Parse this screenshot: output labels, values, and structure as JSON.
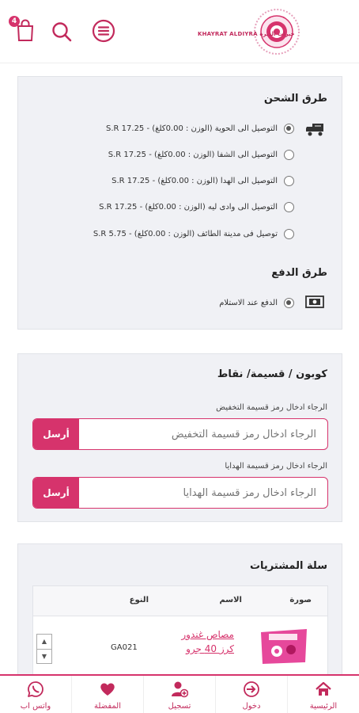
{
  "header": {
    "cart_count": "4",
    "logo_text": "KHAYRAT ALDIYRA خيرات الديرة"
  },
  "shipping": {
    "title": "طرق الشحن",
    "options": [
      {
        "label": "التوصيل الى الحوية (الوزن : 0.00كلغ) - S.R 17.25",
        "selected": true
      },
      {
        "label": "التوصيل الى الشفا (الوزن : 0.00كلغ) - S.R 17.25",
        "selected": false
      },
      {
        "label": "التوصيل الى الهدا (الوزن : 0.00كلغ) - S.R 17.25",
        "selected": false
      },
      {
        "label": "التوصيل الى وادى ليه (الوزن : 0.00كلغ) - S.R 17.25",
        "selected": false
      },
      {
        "label": "توصيل فى مدينة الطائف (الوزن : 0.00كلغ) - S.R 5.75",
        "selected": false
      }
    ]
  },
  "payment": {
    "title": "طرق الدفع",
    "options": [
      {
        "label": "الدفع عند الاستلام",
        "selected": true
      }
    ]
  },
  "coupon": {
    "title": "كوبون / قسيمة/ نقاط",
    "discount_label": "الرجاء ادخال رمز قسيمة التخفيض",
    "discount_placeholder": "الرجاء ادخال رمز قسيمة التخفيض",
    "gift_label": "الرجاء ادخال رمز قسيمة الهدايا",
    "gift_placeholder": "الرجاء ادخال رمز قسيمة الهدايا",
    "send_label": "أرسل"
  },
  "cart": {
    "title": "سلة المشتريات",
    "columns": [
      "صورة",
      "الاسم",
      "النوع"
    ],
    "rows": [
      {
        "name": "مصاص غندور كرز 40 جرو",
        "type": "GA021"
      }
    ]
  },
  "nav": [
    {
      "label": "الرئيسية",
      "icon": "home-icon"
    },
    {
      "label": "دخول",
      "icon": "login-icon"
    },
    {
      "label": "تسجيل",
      "icon": "register-icon"
    },
    {
      "label": "المفضلة",
      "icon": "heart-icon"
    },
    {
      "label": "واتس اب",
      "icon": "whatsapp-icon"
    }
  ],
  "colors": {
    "accent": "#d6336c",
    "card_bg": "#f0f1f5"
  }
}
